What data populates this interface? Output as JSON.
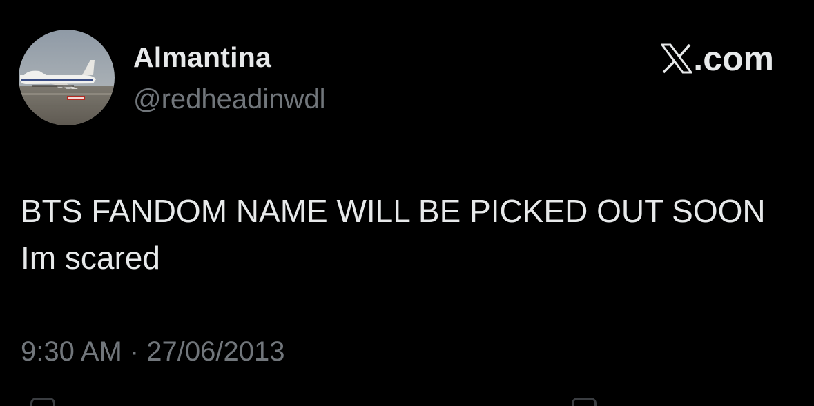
{
  "author": {
    "display_name": "Almantina",
    "handle": "@redheadinwdl",
    "avatar_icon": "airplane-photo-avatar"
  },
  "brand": {
    "label": ".com",
    "logo_icon": "x-logo-icon"
  },
  "tweet": {
    "text": "BTS FANDOM NAME WILL BE PICKED OUT SOON Im scared",
    "timestamp": "9:30 AM · 27/06/2013"
  },
  "colors": {
    "background": "#000000",
    "primary_text": "#e7e9ea",
    "secondary_text": "#71767b"
  }
}
